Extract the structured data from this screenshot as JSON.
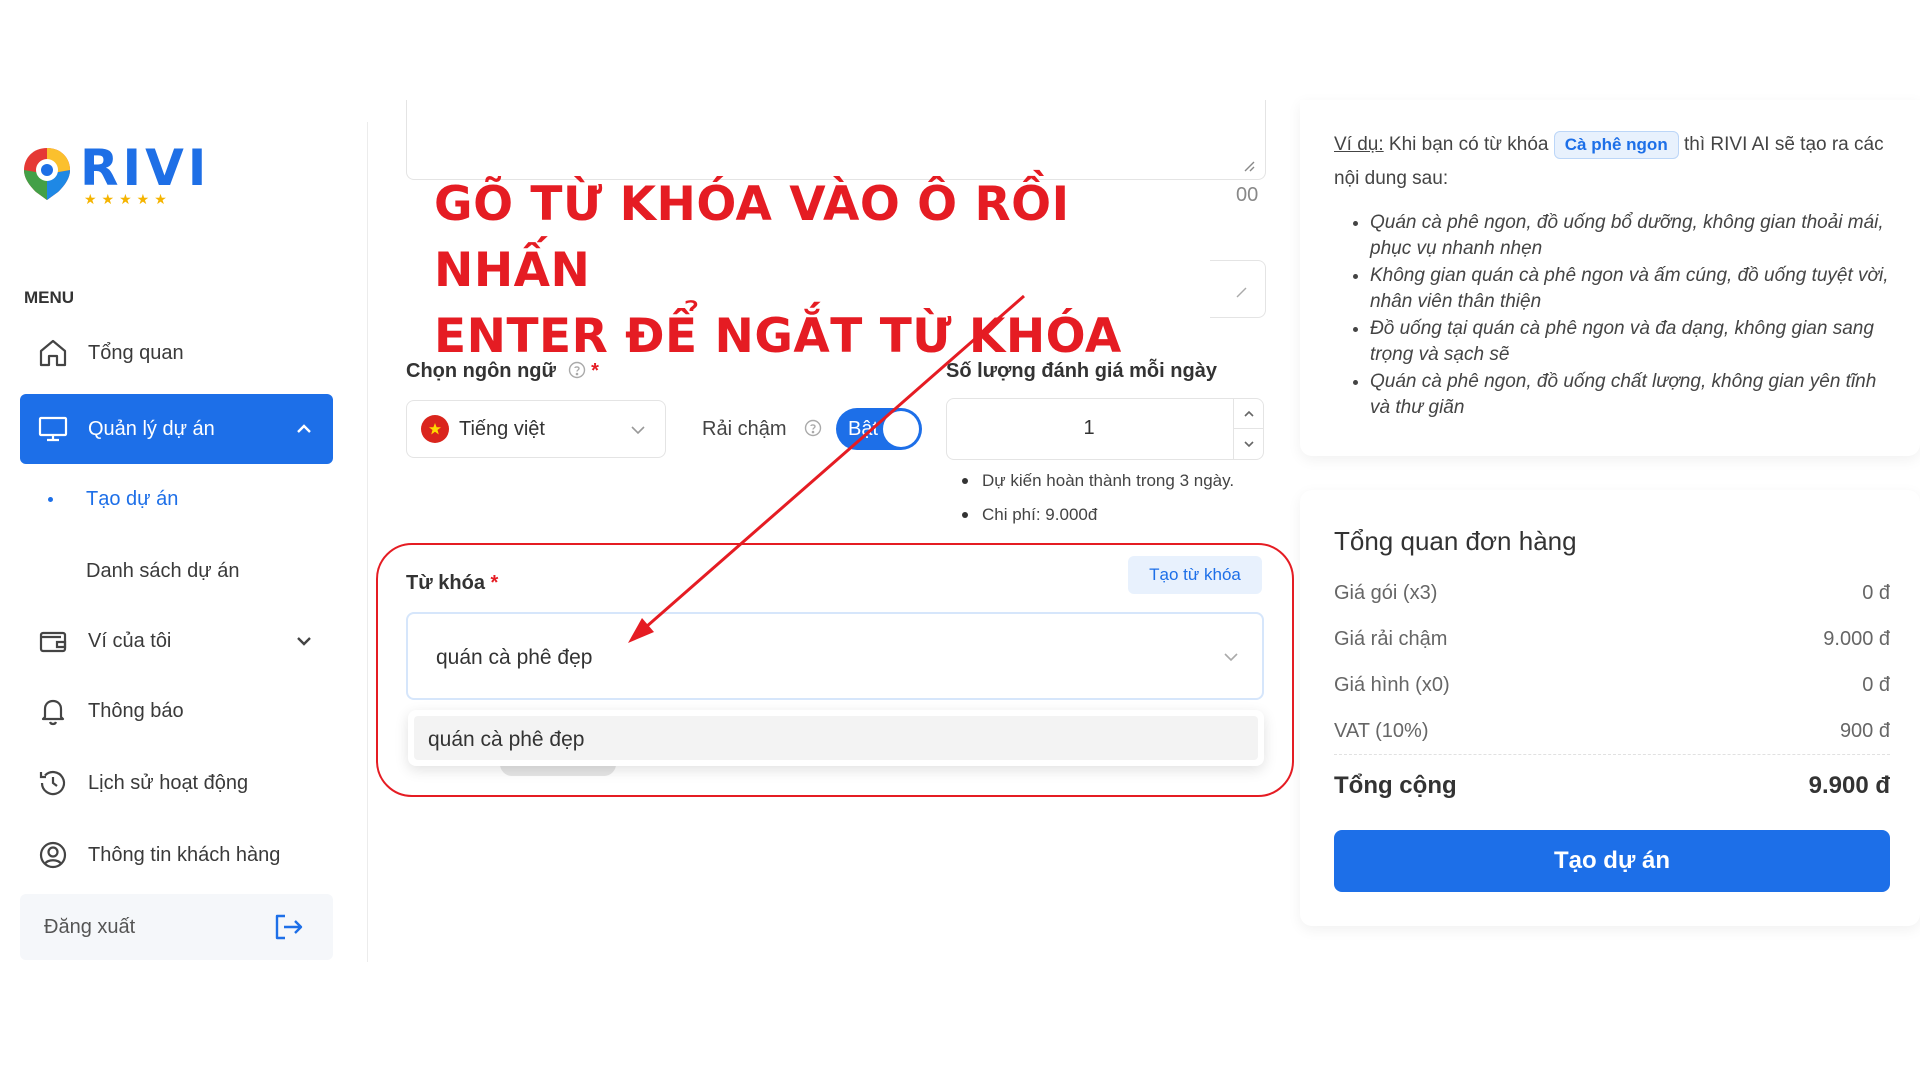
{
  "brand": {
    "name": "RIVI",
    "stars": "★★★★★"
  },
  "sidebar": {
    "menu_title": "MENU",
    "items": [
      {
        "label": "Tổng quan"
      },
      {
        "label": "Quản lý dự án"
      },
      {
        "label": "Tạo dự án"
      },
      {
        "label": "Danh sách dự án"
      },
      {
        "label": "Ví của tôi"
      },
      {
        "label": "Thông báo"
      },
      {
        "label": "Lịch sử hoạt động"
      },
      {
        "label": "Thông tin khách hàng"
      }
    ],
    "logout_label": "Đăng xuất"
  },
  "annotation": {
    "line1": "GÕ TỪ KHÓA VÀO Ô  RỒI NHẤN",
    "line2": "ENTER ĐỂ NGẮT TỪ KHÓA"
  },
  "form": {
    "counter_fragment": "00",
    "language_label": "Chọn ngôn ngữ",
    "required_mark": "*",
    "language_value": "Tiếng việt",
    "slow_label": "Rải chậm",
    "slow_toggle_label": "Bật",
    "qty_label": "Số lượng đánh giá mỗi ngày",
    "qty_value": "1",
    "qty_notes": [
      "Dự kiến hoàn thành trong 3 ngày.",
      "Chi phí: 9.000đ"
    ],
    "keyword_label": "Từ khóa",
    "keyword_generate": "Tạo từ khóa",
    "keyword_value": "quán cà phê đẹp",
    "keyword_suggestion": "quán cà phê đẹp"
  },
  "example": {
    "prefix": "Ví dụ:",
    "text_before": " Khi bạn có từ khóa ",
    "chip": "Cà phê ngon",
    "text_after": " thì RIVI AI sẽ tạo ra các nội dung sau:",
    "items": [
      "Quán cà phê ngon, đồ uống bổ dưỡng, không gian thoải mái, phục vụ nhanh nhẹn",
      "Không gian quán cà phê ngon và ấm cúng, đồ uống tuyệt vời, nhân viên thân thiện",
      "Đồ uống tại quán cà phê ngon và đa dạng, không gian sang trọng và sạch sẽ",
      "Quán cà phê ngon, đồ uống chất lượng, không gian yên tĩnh và thư giãn"
    ]
  },
  "order": {
    "title": "Tổng quan đơn hàng",
    "rows": [
      {
        "label": "Giá gói (x3)",
        "value": "0 đ"
      },
      {
        "label": "Giá rải chậm",
        "value": "9.000 đ"
      },
      {
        "label": "Giá hình (x0)",
        "value": "0 đ"
      },
      {
        "label": "VAT (10%)",
        "value": "900 đ"
      }
    ],
    "total_label": "Tổng cộng",
    "total_value": "9.900 đ",
    "submit_label": "Tạo dự án"
  },
  "colors": {
    "primary": "#1d6fe8",
    "annotation": "#e51c23"
  }
}
